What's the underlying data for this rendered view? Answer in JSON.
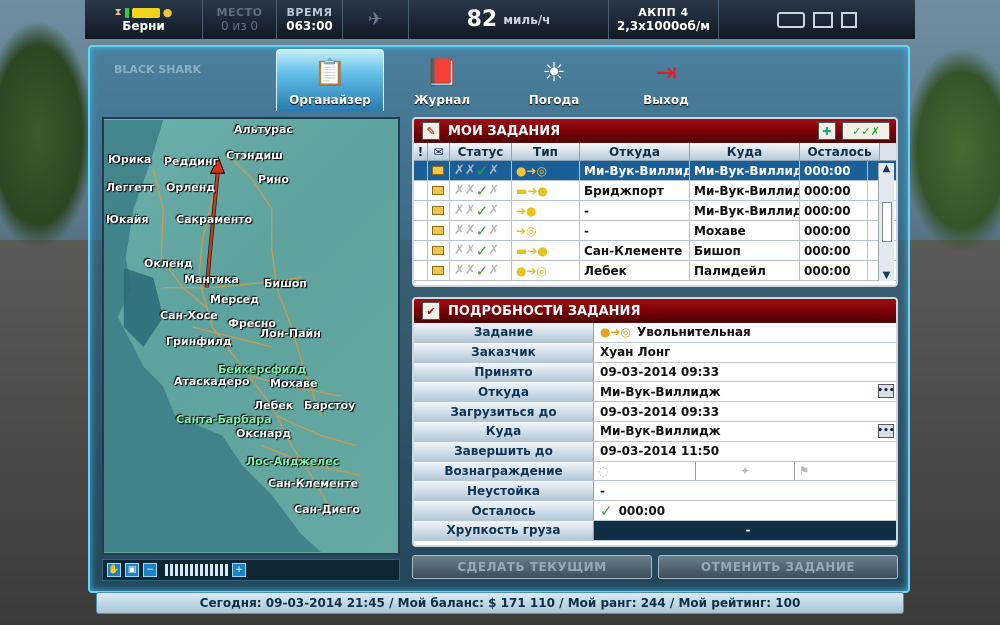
{
  "hud": {
    "location": "Берни",
    "place_label": "МЕСТО",
    "place_value": "0 из 0",
    "time_label": "ВРЕМЯ",
    "time_value": "063:00",
    "speed_value": "82",
    "speed_unit": "миль/ч",
    "gear_label": "АКПП 4",
    "rpm_value": "2,3x1000об/м"
  },
  "tabs": [
    {
      "label": "Органайзер",
      "active": true
    },
    {
      "label": "Журнал",
      "active": false
    },
    {
      "label": "Погода",
      "active": false
    },
    {
      "label": "Выход",
      "active": false
    }
  ],
  "logo_text": "BLACK SHARK",
  "map": {
    "cities": [
      {
        "name": "Альтурас",
        "green": false
      },
      {
        "name": "Юрика",
        "green": false
      },
      {
        "name": "Реддинг",
        "green": false
      },
      {
        "name": "Стэндиш",
        "green": false
      },
      {
        "name": "Леггетт",
        "green": false
      },
      {
        "name": "Орленд",
        "green": false
      },
      {
        "name": "Рино",
        "green": false
      },
      {
        "name": "Юкайя",
        "green": false
      },
      {
        "name": "Сакраменто",
        "green": false
      },
      {
        "name": "Окленд",
        "green": false
      },
      {
        "name": "Мантика",
        "green": false
      },
      {
        "name": "Бишоп",
        "green": false
      },
      {
        "name": "Мерсед",
        "green": false
      },
      {
        "name": "Сан-Хосе",
        "green": false
      },
      {
        "name": "Фресно",
        "green": false
      },
      {
        "name": "Лон-Пайн",
        "green": false
      },
      {
        "name": "Гринфилд",
        "green": false
      },
      {
        "name": "Бейкерсфилд",
        "green": true
      },
      {
        "name": "Атаскадеро",
        "green": false
      },
      {
        "name": "Мохаве",
        "green": false
      },
      {
        "name": "Лебек",
        "green": false
      },
      {
        "name": "Барстоу",
        "green": false
      },
      {
        "name": "Санта-Барбара",
        "green": true
      },
      {
        "name": "Окснард",
        "green": false
      },
      {
        "name": "Лос-Анджелес",
        "green": true
      },
      {
        "name": "Сан-Клементе",
        "green": false
      },
      {
        "name": "Сан-Диего",
        "green": false
      }
    ]
  },
  "tasks": {
    "title": "МОИ ЗАДАНИЯ",
    "columns": [
      "!",
      "✉",
      "Статус",
      "Тип",
      "Откуда",
      "Куда",
      "Осталось"
    ],
    "rows": [
      {
        "from": "Ми-Вук-Виллидж",
        "to": "Ми-Вук-Виллидж",
        "left": "000:00",
        "selected": true
      },
      {
        "from": "Бриджпорт",
        "to": "Ми-Вук-Виллидж",
        "left": "000:00",
        "selected": false
      },
      {
        "from": "-",
        "to": "Ми-Вук-Виллидж",
        "left": "000:00",
        "selected": false
      },
      {
        "from": "-",
        "to": "Мохаве",
        "left": "000:00",
        "selected": false
      },
      {
        "from": "Сан-Клементе",
        "to": "Бишоп",
        "left": "000:00",
        "selected": false
      },
      {
        "from": "Лебек",
        "to": "Палмдейл",
        "left": "000:00",
        "selected": false
      }
    ]
  },
  "details": {
    "title": "ПОДРОБНОСТИ ЗАДАНИЯ",
    "rows": [
      {
        "label": "Задание",
        "value": "Увольнительная"
      },
      {
        "label": "Заказчик",
        "value": "Хуан Лонг"
      },
      {
        "label": "Принято",
        "value": "09-03-2014 09:33"
      },
      {
        "label": "Откуда",
        "value": "Ми-Вук-Виллидж"
      },
      {
        "label": "Загрузиться до",
        "value": "09-03-2014 09:33"
      },
      {
        "label": "Куда",
        "value": "Ми-Вук-Виллидж"
      },
      {
        "label": "Завершить до",
        "value": "09-03-2014 11:50"
      },
      {
        "label": "Вознаграждение",
        "value": ""
      },
      {
        "label": "Неустойка",
        "value": "-"
      },
      {
        "label": "Осталось",
        "value": "000:00"
      },
      {
        "label": "Хрупкость груза",
        "value": "-"
      }
    ]
  },
  "buttons": {
    "make_current": "СДЕЛАТЬ ТЕКУЩИМ",
    "cancel_task": "ОТМЕНИТЬ ЗАДАНИЕ"
  },
  "status": "Сегодня: 09-03-2014 21:45 / Мой баланс: $ 171 110 / Мой ранг: 244 / Мой рейтинг: 100"
}
